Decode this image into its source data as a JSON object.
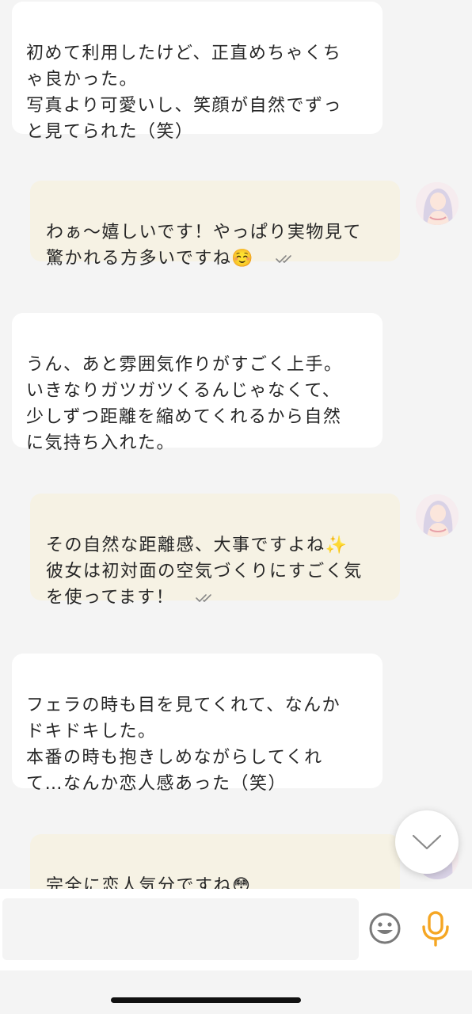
{
  "messages": [
    {
      "from": "user",
      "text": "初めて利用したけど、正直めちゃくち\nゃ良かった。\n写真より可愛いし、笑顔が自然でずっ\nと見てられた（笑）"
    },
    {
      "from": "shop",
      "text": "わぁ〜嬉しいです！やっぱり実物見て\n驚かれる方多いですね☺️",
      "read": true
    },
    {
      "from": "user",
      "text": "うん、あと雰囲気作りがすごく上手。\nいきなりガツガツくるんじゃなくて、\n少しずつ距離を縮めてくれるから自然\nに気持ち入れた。"
    },
    {
      "from": "shop",
      "text": "その自然な距離感、大事ですよね✨\n彼女は初対面の空気づくりにすごく気\nを使ってます！",
      "read": true
    },
    {
      "from": "user",
      "text": "フェラの時も目を見てくれて、なんか\nドキドキした。\n本番の時も抱きしめながらしてくれ\nて…なんか恋人感あった（笑）"
    },
    {
      "from": "shop",
      "text": "完全に恋人気分ですね😳\n気に入っていただけて何よりです！",
      "read": false
    }
  ],
  "input": {
    "value": "",
    "placeholder": ""
  },
  "icons": {
    "read_receipt": "double-check-icon",
    "scroll_down": "chevron-down-icon",
    "emoji": "smiley-icon",
    "mic": "microphone-icon"
  },
  "colors": {
    "background": "#f4f4f4",
    "incoming_bubble": "#ffffff",
    "outgoing_bubble": "#f6f2e4",
    "accent": "#f5a623",
    "icon_gray": "#7a7a7a"
  }
}
